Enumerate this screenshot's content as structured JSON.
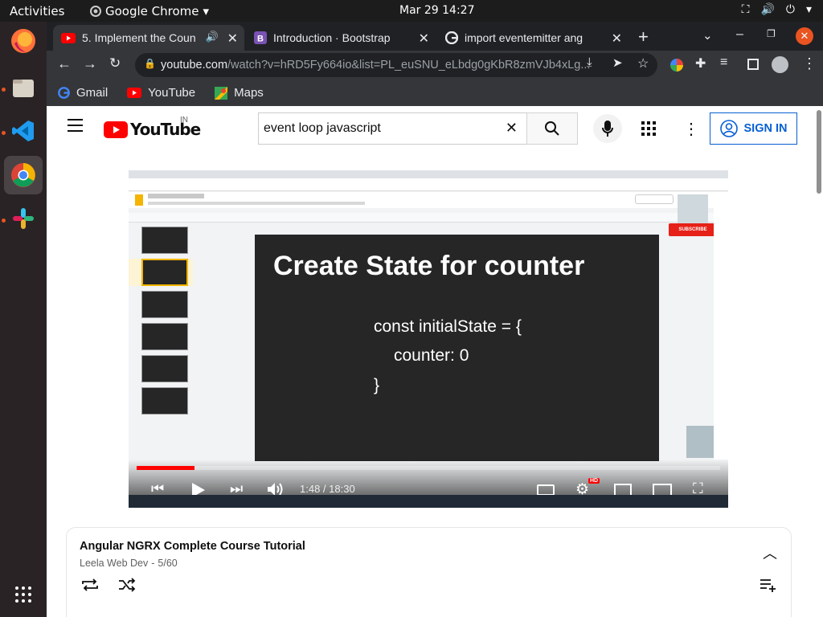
{
  "system": {
    "activities": "Activities",
    "app_name": "Google Chrome",
    "clock": "Mar 29  14:27"
  },
  "dock": {
    "items": [
      "firefox-icon",
      "files-icon",
      "vscode-icon",
      "chrome-icon",
      "slack-icon"
    ],
    "apps_grid": "apps-grid-icon"
  },
  "browser": {
    "tabs": [
      {
        "title": "5. Implement the Coun",
        "icon": "youtube-icon",
        "active": true,
        "audio": true
      },
      {
        "title": "Introduction · Bootstrap",
        "icon": "bootstrap-icon",
        "active": false
      },
      {
        "title": "import eventemitter ang",
        "icon": "google-icon",
        "active": false
      }
    ],
    "url_domain": "youtube.com",
    "url_rest": "/watch?v=hRD5Fy664io&list=PL_euSNU_eLbdg0gKbR8zmVJb4xLg...",
    "bookmarks": [
      {
        "label": "Gmail",
        "icon": "google-icon"
      },
      {
        "label": "YouTube",
        "icon": "youtube-icon"
      },
      {
        "label": "Maps",
        "icon": "maps-icon"
      }
    ]
  },
  "youtube": {
    "logo_text": "YouTube",
    "region": "IN",
    "search_value": "event loop javascript",
    "sign_in": "SIGN IN"
  },
  "video": {
    "slide_title": "Create State for counter",
    "code_line1": "const initialState = {",
    "code_line2": "counter: 0",
    "code_line3": "}",
    "time": "1:48 / 18:30",
    "progress": 0.099,
    "hd_badge": "HD",
    "subscribe": "SUBSCRIBE"
  },
  "playlist": {
    "title": "Angular NGRX Complete Course Tutorial",
    "channel": "Leela Web Dev",
    "position": "5/60"
  },
  "colors": {
    "youtube_red": "#ff0000",
    "link_blue": "#065fd4",
    "ubuntu_orange": "#e95420"
  }
}
